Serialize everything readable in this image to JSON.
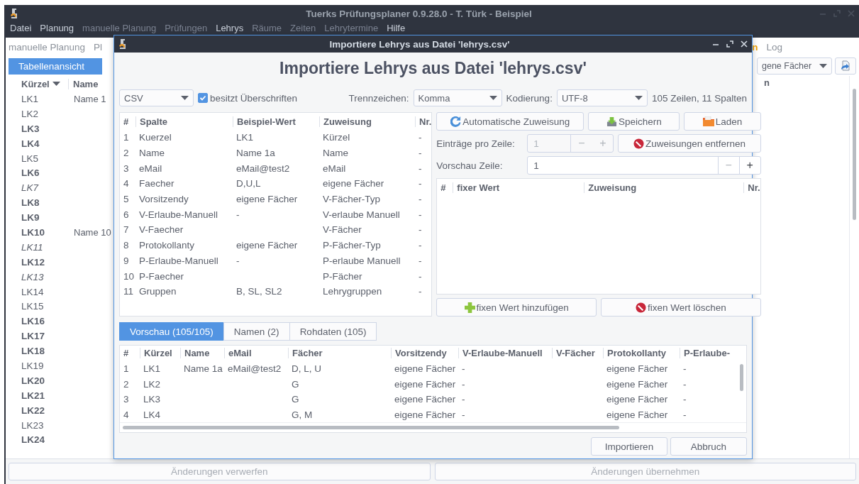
{
  "window": {
    "title": "Tuerks Prüfungsplaner 0.9.28.0 - T. Türk - Beispiel"
  },
  "menu": [
    {
      "label": "Datei",
      "enabled": true
    },
    {
      "label": "Planung",
      "enabled": true
    },
    {
      "label": "manuelle Planung",
      "enabled": false
    },
    {
      "label": "Prüfungen",
      "enabled": false
    },
    {
      "label": "Lehrys",
      "enabled": true
    },
    {
      "label": "Räume",
      "enabled": false
    },
    {
      "label": "Zeiten",
      "enabled": false
    },
    {
      "label": "Lehrytermine",
      "enabled": false
    },
    {
      "label": "Hilfe",
      "enabled": true
    }
  ],
  "toolbar": {
    "left": [
      {
        "label": "manuelle Planung",
        "selected": false
      },
      {
        "label": "Pl",
        "selected": false
      }
    ],
    "right": [
      {
        "label": "n",
        "selected": true
      },
      {
        "label": "Log",
        "selected": false
      }
    ]
  },
  "view_tabs": [
    {
      "label": "Tabellenansicht",
      "selected": true
    }
  ],
  "filter": {
    "value": "gene Fächer"
  },
  "list": {
    "columns": [
      "Kürzel",
      "Name"
    ],
    "right_column": "n",
    "rows": [
      {
        "kuerzel": "LK1",
        "name": "Name 1",
        "kind": "normal"
      },
      {
        "kuerzel": "LK2",
        "kind": "normal"
      },
      {
        "kuerzel": "LK3",
        "kind": "bold"
      },
      {
        "kuerzel": "LK4",
        "kind": "bold"
      },
      {
        "kuerzel": "LK5",
        "kind": "normal"
      },
      {
        "kuerzel": "LK6",
        "kind": "bold"
      },
      {
        "kuerzel": "LK7",
        "kind": "italic"
      },
      {
        "kuerzel": "LK8",
        "kind": "bold"
      },
      {
        "kuerzel": "LK9",
        "kind": "bold"
      },
      {
        "kuerzel": "LK10",
        "name": "Name 10",
        "kind": "bold"
      },
      {
        "kuerzel": "LK11",
        "kind": "italic"
      },
      {
        "kuerzel": "LK12",
        "kind": "bold"
      },
      {
        "kuerzel": "LK13",
        "kind": "italic"
      },
      {
        "kuerzel": "LK14",
        "kind": "normal"
      },
      {
        "kuerzel": "LK15",
        "kind": "normal"
      },
      {
        "kuerzel": "LK16",
        "kind": "bold"
      },
      {
        "kuerzel": "LK17",
        "kind": "bold"
      },
      {
        "kuerzel": "LK18",
        "kind": "bold"
      },
      {
        "kuerzel": "LK19",
        "kind": "normal"
      },
      {
        "kuerzel": "LK20",
        "kind": "bold"
      },
      {
        "kuerzel": "LK21",
        "kind": "bold"
      },
      {
        "kuerzel": "LK22",
        "kind": "bold"
      },
      {
        "kuerzel": "LK23",
        "kind": "normal"
      },
      {
        "kuerzel": "LK24",
        "kind": "bold"
      }
    ]
  },
  "bottom_buttons": [
    {
      "label": "Änderungen verwerfen",
      "disabled": true
    },
    {
      "label": "Änderungen übernehmen",
      "disabled": true
    }
  ],
  "dialog": {
    "title": "Importiere Lehrys aus Datei 'lehrys.csv'",
    "heading": "Importiere Lehrys aus Datei 'lehrys.csv'",
    "format": "CSV",
    "has_headers": {
      "label": "besitzt Überschriften",
      "checked": true
    },
    "separator": {
      "label": "Trennzeichen:",
      "value": "Komma"
    },
    "encoding": {
      "label": "Kodierung:",
      "value": "UTF-8"
    },
    "summary": "105 Zeilen, 11 Spalten",
    "columns_table": {
      "columns": [
        "#",
        "Spalte",
        "Beispiel-Wert",
        "Zuweisung",
        "Nr."
      ],
      "rows": [
        [
          "1",
          "Kuerzel",
          "LK1",
          "Kürzel",
          "-"
        ],
        [
          "2",
          "Name",
          "Name 1a",
          "Name",
          "-"
        ],
        [
          "3",
          "eMail",
          "eMail@test2",
          "eMail",
          "-"
        ],
        [
          "4",
          "Faecher",
          "D,U,L",
          "eigene Fächer",
          "-"
        ],
        [
          "5",
          "Vorsitzendy",
          "eigene Fächer",
          "V-Fächer-Typ",
          "-"
        ],
        [
          "6",
          "V-Erlaube-Manuell",
          "-",
          "V-erlaube Manuell",
          "-"
        ],
        [
          "7",
          "V-Faecher",
          "",
          "V-Fächer",
          "-"
        ],
        [
          "8",
          "Protokollanty",
          "eigene Fächer",
          "P-Fächer-Typ",
          "-"
        ],
        [
          "9",
          "P-Erlaube-Manuell",
          "-",
          "P-erlaube Manuell",
          "-"
        ],
        [
          "10",
          "P-Faecher",
          "",
          "P-Fächer",
          "-"
        ],
        [
          "11",
          "Gruppen",
          "B, SL, SL2",
          "Lehrygruppen",
          "-"
        ]
      ]
    },
    "action_buttons": [
      {
        "label": "Automatische Zuweisung",
        "kind": "refresh"
      },
      {
        "label": "Speichern",
        "kind": "save"
      },
      {
        "label": "Laden",
        "kind": "folder"
      }
    ],
    "entries_per_row": {
      "label": "Einträge pro Zeile:",
      "value": "1",
      "disabled": true,
      "minus": "−",
      "plus": "+",
      "minus_disabled": true,
      "plus_disabled": true
    },
    "remove_button": {
      "label": "Zuweisungen entfernen"
    },
    "preview_row": {
      "label": "Vorschau Zeile:",
      "value": "1",
      "disabled": false,
      "minus": "−",
      "plus": "+",
      "minus_disabled": true,
      "plus_disabled": false
    },
    "fixed_table": {
      "columns": [
        "#",
        "fixer Wert",
        "Zuweisung",
        "Nr."
      ]
    },
    "fixed_buttons": [
      {
        "label": "fixen Wert hinzufügen",
        "kind": "add"
      },
      {
        "label": "fixen Wert löschen",
        "kind": "delete"
      }
    ],
    "tabs": [
      {
        "label": "Vorschau (105/105)",
        "selected": true
      },
      {
        "label": "Namen (2)",
        "selected": false
      },
      {
        "label": "Rohdaten (105)",
        "selected": false
      }
    ],
    "preview_table": {
      "columns": [
        "#",
        "Kürzel",
        "Name",
        "eMail",
        "Fächer",
        "Vorsitzendy",
        "V-Erlaube-Manuell",
        "V-Fächer",
        "Protokollanty",
        "P-Erlaube-"
      ],
      "rows": [
        [
          "1",
          "LK1",
          "Name 1a",
          "eMail@test2",
          "D, L, U",
          "eigene Fächer",
          "-",
          "",
          "eigene Fächer",
          "-"
        ],
        [
          "2",
          "LK2",
          "",
          "",
          "G",
          "eigene Fächer",
          "-",
          "",
          "eigene Fächer",
          "-"
        ],
        [
          "3",
          "LK3",
          "",
          "",
          "G",
          "eigene Fächer",
          "-",
          "",
          "eigene Fächer",
          "-"
        ],
        [
          "4",
          "LK4",
          "",
          "",
          "G, M",
          "eigene Fächer",
          "-",
          "",
          "eigene Fächer",
          "-"
        ]
      ]
    },
    "buttons": [
      {
        "label": "Importieren"
      },
      {
        "label": "Abbruch"
      }
    ]
  }
}
